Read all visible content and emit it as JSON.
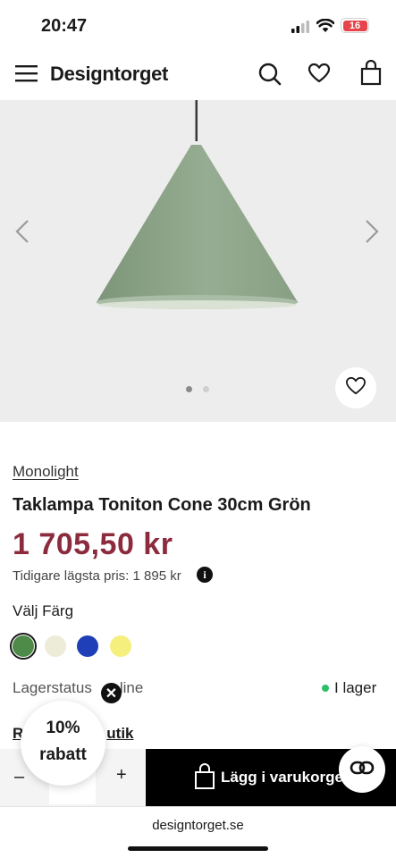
{
  "status_bar": {
    "time": "20:47",
    "battery": "16"
  },
  "header": {
    "brand": "Designtorget"
  },
  "gallery": {
    "active_dot": 0,
    "dot_count": 2
  },
  "product": {
    "brand": "Monolight",
    "title": "Taklampa Toniton Cone 30cm Grön",
    "price": "1 705,50 kr",
    "previous_price": "Tidigare lägsta pris: 1 895 kr",
    "info_icon": "i",
    "color_label": "Välj Färg",
    "colors": [
      {
        "name": "green",
        "hex": "#4e8a48",
        "selected": true
      },
      {
        "name": "cream",
        "hex": "#ececd9",
        "selected": false
      },
      {
        "name": "blue",
        "hex": "#1e3fb8",
        "selected": false
      },
      {
        "name": "yellow",
        "hex": "#f5f07d",
        "selected": false
      }
    ],
    "stock_label": "Lagerstatus",
    "stock_online": "line",
    "stock_status": "I lager",
    "store_link": "R",
    "store_link_end": "utik"
  },
  "cart": {
    "minus": "–",
    "plus": "+",
    "add_label": "Lägg i varukorge"
  },
  "promo": {
    "line1": "10%",
    "line2": "rabatt"
  },
  "browser": {
    "url": "designtorget.se"
  },
  "colors": {
    "price": "#8c2a3e",
    "stock_dot": "#2fbf6a",
    "lamp": "#91a88e"
  }
}
